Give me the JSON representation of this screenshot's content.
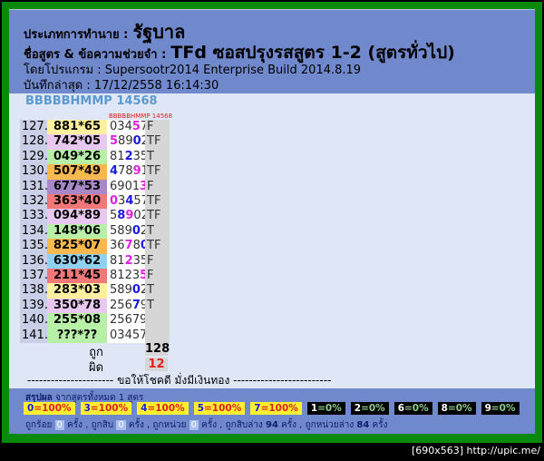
{
  "header": {
    "type_label": "ประเภทการทำนาย :",
    "type_value": "รัฐบาล",
    "formula_label": "ชื่อสูตร & ข้อความช่วยจำ :",
    "formula_value": "TFd ซอสปรุงรสสูตร 1-2 (สูตรทั่วไป)",
    "program_line": "โดยโปรแกรม : Supersootr2014 Enterprise Build 2014.8.19",
    "saved_line": "บันทึกล่าสุด : 17/12/2558 16:14:30"
  },
  "subtitle": "BBBBBHMMP 14568",
  "column_caption": "BBBBBHMMP 14568",
  "rows": [
    {
      "num": "127.",
      "formula": "881*65",
      "bg": "#fff0a0",
      "digits": "03457",
      "marks": "...m.",
      "result": "F"
    },
    {
      "num": "128.",
      "formula": "742*05",
      "bg": "#e8c8f0",
      "digits": "58902",
      "marks": "m..b.",
      "result": "TF"
    },
    {
      "num": "129.",
      "formula": "049*26",
      "bg": "#b8f0a8",
      "digits": "81235",
      "marks": "..b..",
      "result": "T"
    },
    {
      "num": "130.",
      "formula": "507*49",
      "bg": "#f8b850",
      "digits": "47891",
      "marks": "b..m.",
      "result": "TF"
    },
    {
      "num": "131.",
      "formula": "677*53",
      "bg": "#a888c8",
      "digits": "69013",
      "marks": "....m",
      "result": "F"
    },
    {
      "num": "132.",
      "formula": "363*40",
      "bg": "#f07878",
      "digits": "03457",
      "marks": "m.b..",
      "result": "TF"
    },
    {
      "num": "133.",
      "formula": "094*89",
      "bg": "#e8c8f0",
      "digits": "58902",
      "marks": ".bm..",
      "result": "TF"
    },
    {
      "num": "134.",
      "formula": "148*06",
      "bg": "#b8f0a8",
      "digits": "58902",
      "marks": "...b.",
      "result": "T"
    },
    {
      "num": "135.",
      "formula": "825*07",
      "bg": "#f8b850",
      "digits": "36780",
      "marks": "..m.b",
      "result": "TF"
    },
    {
      "num": "136.",
      "formula": "630*62",
      "bg": "#90d0f0",
      "digits": "81235",
      "marks": "..m..",
      "result": "F"
    },
    {
      "num": "137.",
      "formula": "211*45",
      "bg": "#f07878",
      "digits": "81235",
      "marks": "....m",
      "result": "F"
    },
    {
      "num": "138.",
      "formula": "283*03",
      "bg": "#fff0a0",
      "digits": "58902",
      "marks": "...b.",
      "result": "T"
    },
    {
      "num": "139.",
      "formula": "350*78",
      "bg": "#e8c8f0",
      "digits": "25679",
      "marks": "...b.",
      "result": "T"
    },
    {
      "num": "140.",
      "formula": "255*08",
      "bg": "#b8f0a8",
      "digits": "25679",
      "marks": ".....",
      "result": ""
    },
    {
      "num": "141.",
      "formula": "???*??",
      "bg": "#b8f0a8",
      "digits": "03457",
      "marks": ".....",
      "result": ""
    }
  ],
  "totals": {
    "correct_label": "ถูก",
    "correct_value": "128",
    "wrong_label": "ผิด",
    "wrong_value": "12"
  },
  "luck_line": "---------------------- ขอให้โชคดี มั่งมีเงินทอง -------------------------",
  "footer": {
    "summary_bold": "สรุปผล",
    "summary_rest": " จากสูตรทั้งหมด 1 สูตร",
    "badges": [
      {
        "d": "0",
        "p": "=100%",
        "style": "yellow"
      },
      {
        "d": "3",
        "p": "=100%",
        "style": "yellow"
      },
      {
        "d": "4",
        "p": "=100%",
        "style": "yellow"
      },
      {
        "d": "5",
        "p": "=100%",
        "style": "yellow"
      },
      {
        "d": "7",
        "p": "=100%",
        "style": "yellow"
      },
      {
        "d": "1",
        "p": "=0%",
        "style": "black"
      },
      {
        "d": "2",
        "p": "=0%",
        "style": "black"
      },
      {
        "d": "6",
        "p": "=0%",
        "style": "black"
      },
      {
        "d": "8",
        "p": "=0%",
        "style": "black"
      },
      {
        "d": "9",
        "p": "=0%",
        "style": "black"
      }
    ],
    "stats": [
      {
        "label": "ถูกร้อย ",
        "value": "0",
        "unit": " ครั้ง , ",
        "zero": true
      },
      {
        "label": "ถูกสิบ ",
        "value": "0",
        "unit": " ครั้ง , ",
        "zero": true
      },
      {
        "label": "ถูกหน่วย ",
        "value": "0",
        "unit": " ครั้ง , ",
        "zero": true
      },
      {
        "label": "ถูกสิบล่าง ",
        "value": "94",
        "unit": " ครั้ง , ",
        "zero": false
      },
      {
        "label": "ถูกหน่วยล่าง ",
        "value": "84",
        "unit": " ครั้ง",
        "zero": false
      }
    ]
  },
  "credit": "[690x563] http://upic.me/",
  "colors": {
    "frame": "#0a8a0a",
    "header": "#7088cc",
    "body": "#dfe6f6",
    "magenta": "#e020e0",
    "blue": "#1a1ae0",
    "wrong": "#e02020"
  }
}
